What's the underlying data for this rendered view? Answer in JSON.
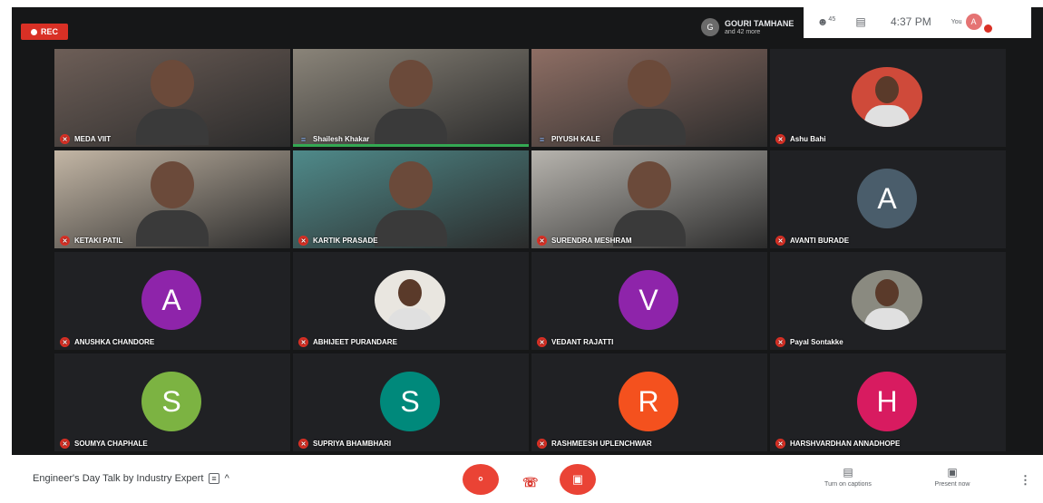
{
  "recording": {
    "label": "REC"
  },
  "presenter": {
    "initial": "G",
    "name": "GOURI TAMHANE",
    "subtitle": "and 42 more"
  },
  "tray": {
    "people_icon": "people-icon",
    "chat_icon": "chat-icon",
    "time": "4:37 PM",
    "you_label": "You",
    "user_initial": "A"
  },
  "tiles": [
    {
      "name": "MEDA VIIT",
      "kind": "video",
      "muted": true,
      "bg": "#6d5e57"
    },
    {
      "name": "Shailesh Khakar",
      "kind": "video",
      "muted": false,
      "bg": "#8a8479",
      "speaking": true
    },
    {
      "name": "PIYUSH KALE",
      "kind": "video",
      "muted": false,
      "bg": "#8e6e64"
    },
    {
      "name": "Ashu Bahi",
      "kind": "photo",
      "muted": true,
      "bg": "#cf4a3a"
    },
    {
      "name": "KETAKI PATIL",
      "kind": "video",
      "muted": true,
      "bg": "#c3b6a5"
    },
    {
      "name": "KARTIK PRASADE",
      "kind": "video",
      "muted": true,
      "bg": "#4f8a8a"
    },
    {
      "name": "SURENDRA MESHRAM",
      "kind": "video",
      "muted": true,
      "bg": "#b7b4ae"
    },
    {
      "name": "AVANTI BURADE",
      "kind": "letter",
      "letter": "A",
      "muted": true,
      "color": "#4a5d6b"
    },
    {
      "name": "ANUSHKA CHANDORE",
      "kind": "letter",
      "letter": "A",
      "muted": true,
      "color": "#8e24aa"
    },
    {
      "name": "ABHIJEET PURANDARE",
      "kind": "photo",
      "muted": true,
      "bg": "#e9e6e0"
    },
    {
      "name": "VEDANT RAJATTI",
      "kind": "letter",
      "letter": "V",
      "muted": true,
      "color": "#8e24aa"
    },
    {
      "name": "Payal Sontakke",
      "kind": "photo",
      "muted": true,
      "bg": "#8a8a80"
    },
    {
      "name": "SOUMYA CHAPHALE",
      "kind": "letter",
      "letter": "S",
      "muted": true,
      "color": "#7cb342"
    },
    {
      "name": "SUPRIYA BHAMBHARI",
      "kind": "letter",
      "letter": "S",
      "muted": true,
      "color": "#00897b"
    },
    {
      "name": "RASHMEESH UPLENCHWAR",
      "kind": "letter",
      "letter": "R",
      "muted": true,
      "color": "#f4511e"
    },
    {
      "name": "HARSHVARDHAN ANNADHOPE",
      "kind": "letter",
      "letter": "H",
      "muted": true,
      "color": "#d81b60"
    }
  ],
  "bottom": {
    "meeting_title": "Engineer's Day Talk by Industry Expert",
    "info_icon": "info-icon",
    "chevron": "^",
    "turn_on_captions": "Turn on captions",
    "present_now": "Present now"
  }
}
